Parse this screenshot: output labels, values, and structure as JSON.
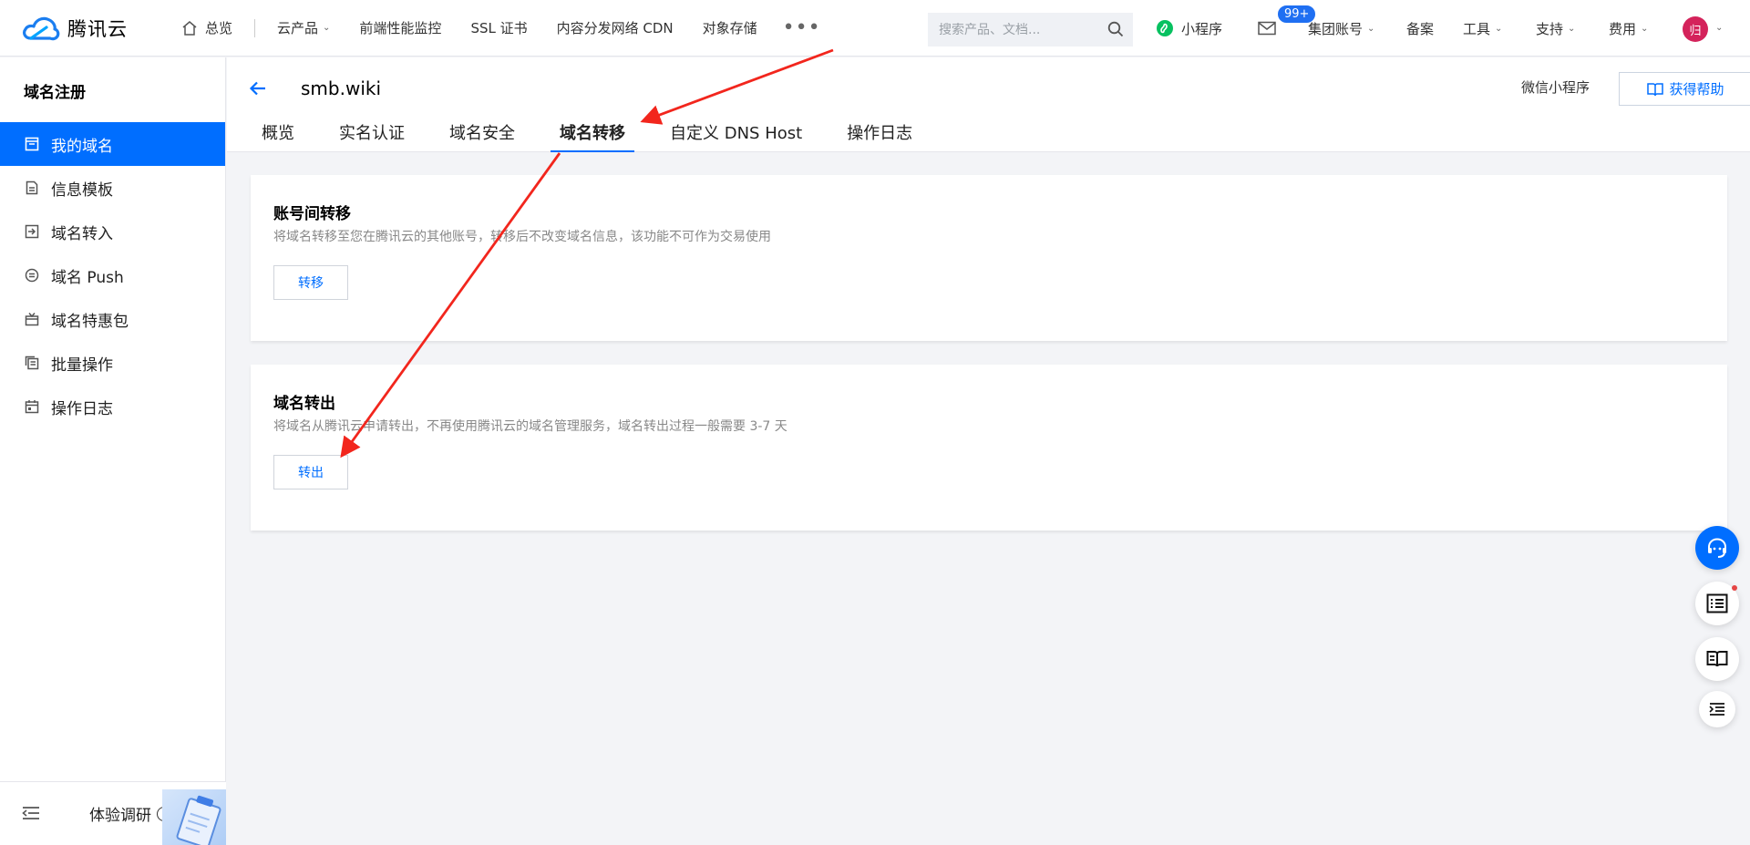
{
  "topbar": {
    "brand": "腾讯云",
    "home": "总览",
    "nav": [
      {
        "label": "云产品",
        "dropdown": true
      },
      {
        "label": "前端性能监控",
        "dropdown": false
      },
      {
        "label": "SSL 证书",
        "dropdown": false
      },
      {
        "label": "内容分发网络 CDN",
        "dropdown": false
      },
      {
        "label": "对象存储",
        "dropdown": false
      }
    ],
    "more": "•••",
    "search_placeholder": "搜索产品、文档...",
    "mini_program": "小程序",
    "message_badge": "99+",
    "group_account": "集团账号",
    "filing": "备案",
    "tools": "工具",
    "support": "支持",
    "billing": "费用",
    "avatar_initial": "归"
  },
  "sidebar": {
    "title": "域名注册",
    "items": [
      {
        "label": "我的域名",
        "icon": "domain-icon",
        "active": true
      },
      {
        "label": "信息模板",
        "icon": "template-icon",
        "active": false
      },
      {
        "label": "域名转入",
        "icon": "transfer-in-icon",
        "active": false
      },
      {
        "label": "域名 Push",
        "icon": "push-icon",
        "active": false
      },
      {
        "label": "域名特惠包",
        "icon": "gift-icon",
        "active": false
      },
      {
        "label": "批量操作",
        "icon": "batch-icon",
        "active": false
      },
      {
        "label": "操作日志",
        "icon": "calendar-icon",
        "active": false
      }
    ],
    "footer_label": "体验调研"
  },
  "header": {
    "domain": "smb.wiki",
    "wechat_mini": "微信小程序",
    "help": "获得帮助",
    "tabs": [
      "概览",
      "实名认证",
      "域名安全",
      "域名转移",
      "自定义 DNS Host",
      "操作日志"
    ],
    "active_tab": "域名转移"
  },
  "cards": [
    {
      "title": "账号间转移",
      "desc": "将域名转移至您在腾讯云的其他账号，转移后不改变域名信息，该功能不可作为交易使用",
      "button": "转移"
    },
    {
      "title": "域名转出",
      "desc": "将域名从腾讯云申请转出，不再使用腾讯云的域名管理服务，域名转出过程一般需要 3-7 天",
      "button": "转出"
    }
  ],
  "colors": {
    "accent": "#006eff",
    "annotation": "#f2261d",
    "avatar": "#d4235b"
  }
}
